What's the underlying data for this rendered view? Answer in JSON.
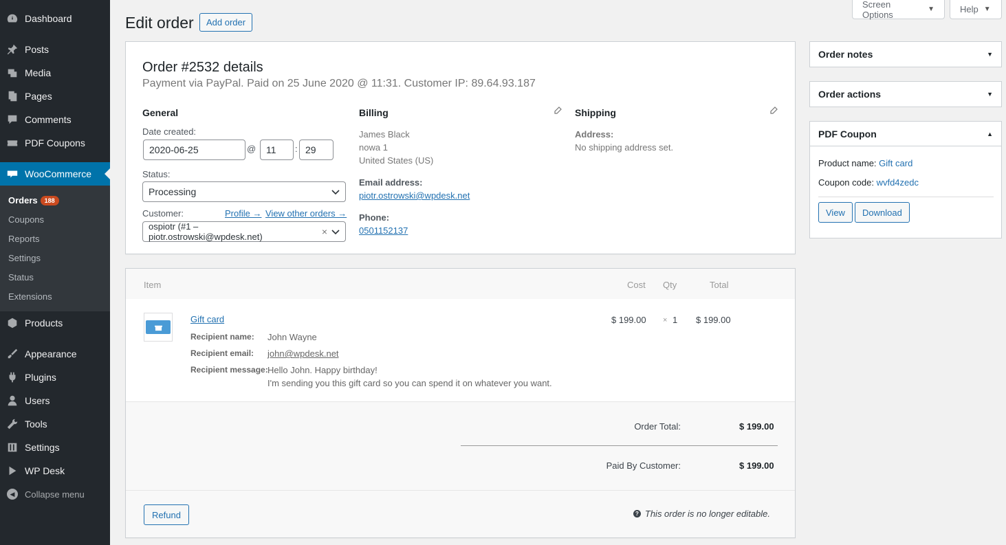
{
  "sidebar": {
    "items": [
      {
        "label": "Dashboard",
        "icon": "dashboard-icon"
      },
      {
        "label": "Posts",
        "icon": "pin-icon"
      },
      {
        "label": "Media",
        "icon": "media-icon"
      },
      {
        "label": "Pages",
        "icon": "pages-icon"
      },
      {
        "label": "Comments",
        "icon": "comment-icon"
      },
      {
        "label": "PDF Coupons",
        "icon": "coupon-icon"
      },
      {
        "label": "WooCommerce",
        "icon": "woocommerce-icon"
      },
      {
        "label": "Products",
        "icon": "box-icon"
      },
      {
        "label": "Appearance",
        "icon": "brush-icon"
      },
      {
        "label": "Plugins",
        "icon": "plug-icon"
      },
      {
        "label": "Users",
        "icon": "user-icon"
      },
      {
        "label": "Tools",
        "icon": "wrench-icon"
      },
      {
        "label": "Settings",
        "icon": "settings-sliders-icon"
      },
      {
        "label": "WP Desk",
        "icon": "play-icon"
      }
    ],
    "submenu": [
      {
        "label": "Orders",
        "badge": "188"
      },
      {
        "label": "Coupons"
      },
      {
        "label": "Reports"
      },
      {
        "label": "Settings"
      },
      {
        "label": "Status"
      },
      {
        "label": "Extensions"
      }
    ],
    "collapse_label": "Collapse menu"
  },
  "topbar": {
    "screen_options": "Screen Options",
    "help": "Help"
  },
  "header": {
    "title": "Edit order",
    "add_button": "Add order"
  },
  "order": {
    "heading": "Order #2532 details",
    "meta": "Payment via PayPal. Paid on 25 June 2020 @ 11:31. Customer IP: 89.64.93.187",
    "general": {
      "title": "General",
      "date_label": "Date created:",
      "date": "2020-06-25",
      "at": "@",
      "hour": "11",
      "colon": ":",
      "minute": "29",
      "status_label": "Status:",
      "status": "Processing",
      "customer_label": "Customer:",
      "profile_link": "Profile →",
      "other_orders_link": "View other orders →",
      "customer": "ospiotr (#1 – piotr.ostrowski@wpdesk.net)",
      "clear": "×"
    },
    "billing": {
      "title": "Billing",
      "name": "James Black",
      "address1": "nowa 1",
      "country": "United States (US)",
      "email_label": "Email address:",
      "email": "piotr.ostrowski@wpdesk.net",
      "phone_label": "Phone:",
      "phone": "0501152137"
    },
    "shipping": {
      "title": "Shipping",
      "address_label": "Address:",
      "address": "No shipping address set."
    }
  },
  "items": {
    "headers": {
      "item": "Item",
      "cost": "Cost",
      "qty": "Qty",
      "total": "Total"
    },
    "rows": [
      {
        "name": "Gift card",
        "cost": "$ 199.00",
        "qty_x": "×",
        "qty": "1",
        "total": "$ 199.00",
        "meta": [
          {
            "label": "Recipient name:",
            "value": "John Wayne"
          },
          {
            "label": "Recipient email:",
            "value": "john@wpdesk.net"
          },
          {
            "label": "Recipient message:",
            "value": "Hello John. Happy birthday!",
            "value2": "I'm sending you this gift card so you can spend it on whatever you want."
          }
        ]
      }
    ],
    "totals": {
      "order_total_label": "Order Total:",
      "order_total": "$ 199.00",
      "paid_label": "Paid By Customer:",
      "paid": "$ 199.00"
    },
    "refund_button": "Refund",
    "not_editable": "This order is no longer editable.",
    "help_glyph": "?"
  },
  "side": {
    "order_notes": "Order notes",
    "order_actions": "Order actions",
    "pdf_coupon": {
      "title": "PDF Coupon",
      "product_label": "Product name:",
      "product": "Gift card",
      "code_label": "Coupon code:",
      "code": "wvfd4zedc",
      "view_button": "View",
      "download_button": "Download"
    },
    "collapse_glyph": "▼",
    "expand_glyph": "▲"
  },
  "colors": {
    "sidebar_bg": "#23282d",
    "submenu_bg": "#32373c",
    "active": "#0073aa",
    "link": "#2271b1",
    "badge": "#ca4a1f"
  }
}
